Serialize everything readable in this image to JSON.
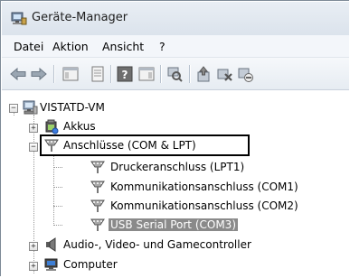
{
  "window": {
    "title": "Geräte-Manager",
    "icon": "device-manager-icon"
  },
  "menu": [
    {
      "label": "Datei"
    },
    {
      "label": "Aktion"
    },
    {
      "label": "Ansicht"
    },
    {
      "label": "?"
    }
  ],
  "toolbar": [
    {
      "icon": "back-arrow-icon"
    },
    {
      "icon": "forward-arrow-icon"
    },
    {
      "icon": "show-hide-console-tree-icon"
    },
    {
      "icon": "properties-icon"
    },
    {
      "icon": "help-icon"
    },
    {
      "icon": "action-pane-icon"
    },
    {
      "icon": "scan-hardware-icon"
    },
    {
      "icon": "update-driver-icon"
    },
    {
      "icon": "uninstall-icon"
    },
    {
      "icon": "disable-device-icon"
    }
  ],
  "tree": {
    "root": {
      "label": "VISTATD-VM",
      "icon": "computer-icon"
    },
    "nodes": [
      {
        "label": "Akkus",
        "icon": "battery-icon",
        "expander": "+"
      },
      {
        "label": "Anschlüsse (COM & LPT)",
        "icon": "port-icon",
        "expander": "−",
        "highlighted": true
      },
      {
        "label": "Druckeranschluss (LPT1)",
        "icon": "port-icon"
      },
      {
        "label": "Kommunikationsanschluss (COM1)",
        "icon": "port-icon"
      },
      {
        "label": "Kommunikationsanschluss (COM2)",
        "icon": "port-icon"
      },
      {
        "label": "USB Serial Port (COM3)",
        "icon": "port-icon",
        "selected": true
      },
      {
        "label": "Audio-, Video- und Gamecontroller",
        "icon": "speaker-icon",
        "expander": "+"
      },
      {
        "label": "Computer",
        "icon": "computer-icon",
        "expander": "+"
      }
    ]
  }
}
